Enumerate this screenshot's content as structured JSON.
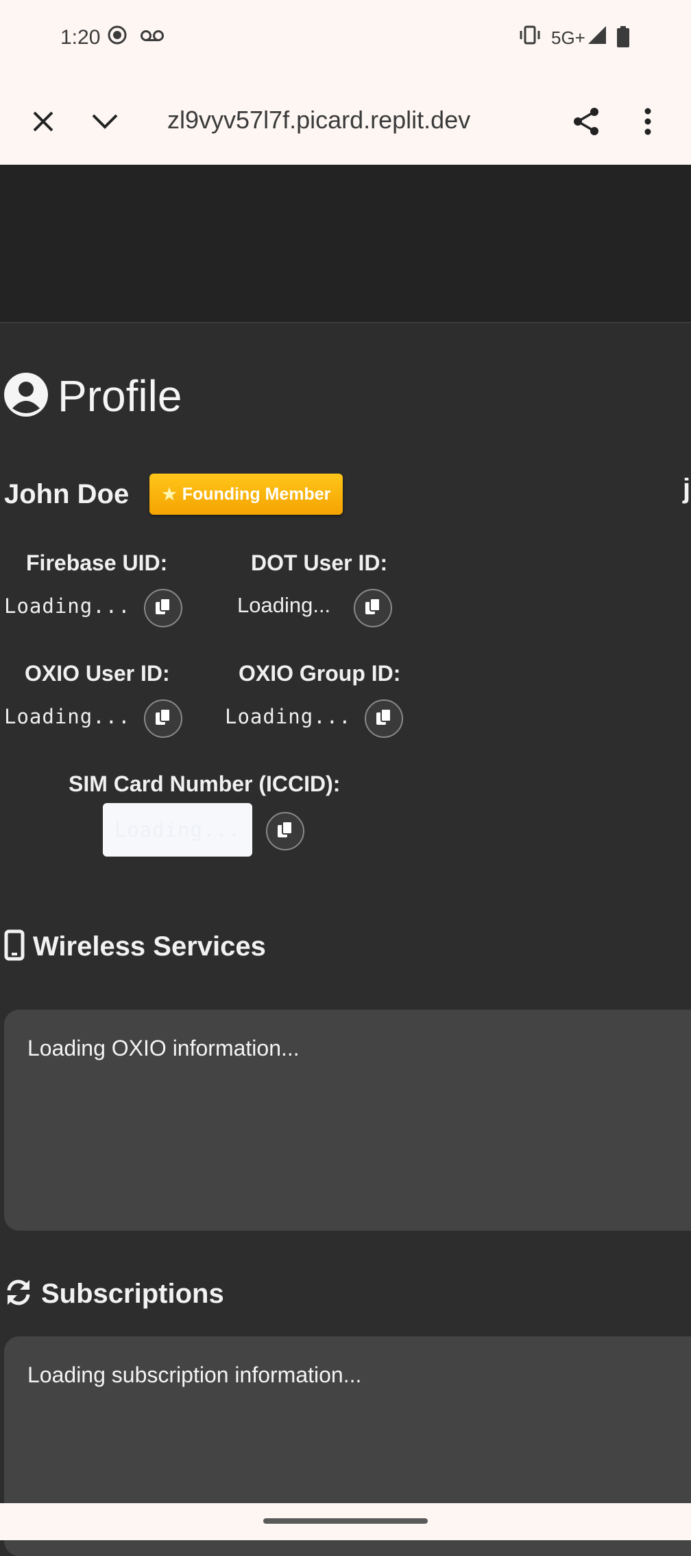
{
  "status_bar": {
    "time": "1:20",
    "network": "5G+"
  },
  "browser": {
    "url": "zl9vyv57l7f.picard.replit.dev",
    "icons": [
      "close-icon",
      "chevron-down-icon",
      "share-icon",
      "more-vert-icon"
    ]
  },
  "profile": {
    "title": "Profile",
    "name": "John Doe",
    "badge": "Founding Member",
    "edge_text": "j",
    "fields": {
      "firebase_uid_label": "Firebase UID:",
      "firebase_uid_value": "Loading...",
      "dot_user_label": "DOT User ID:",
      "dot_user_value": "Loading...",
      "oxio_user_label": "OXIO User ID:",
      "oxio_user_value": "Loading...",
      "oxio_group_label": "OXIO Group ID:",
      "oxio_group_value": "Loading...",
      "iccid_label": "SIM Card Number (ICCID):",
      "iccid_value": "Loading..."
    }
  },
  "wireless": {
    "title": "Wireless Services",
    "message": "Loading OXIO information..."
  },
  "subscriptions": {
    "title": "Subscriptions",
    "message": "Loading subscription information..."
  },
  "colors": {
    "background": "#2d2d2d",
    "header": "#232323",
    "card": "#444444",
    "badge": "#f5a300",
    "chrome": "#fdf6f3"
  }
}
